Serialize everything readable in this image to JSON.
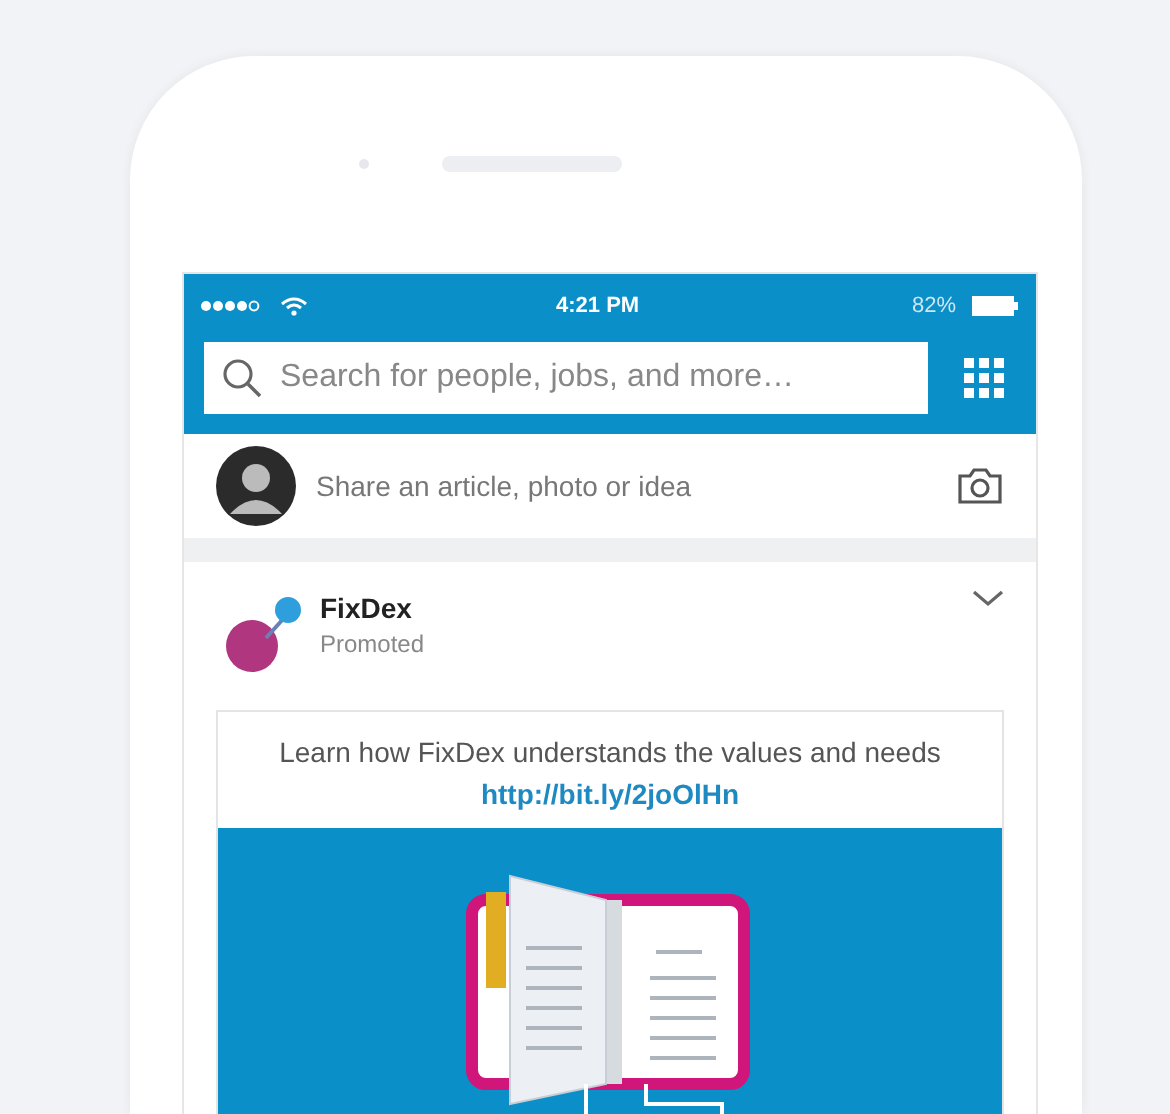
{
  "status_bar": {
    "time": "4:21 PM",
    "battery_text": "82%"
  },
  "search": {
    "placeholder": "Search for people, jobs, and more…"
  },
  "share_box": {
    "placeholder": "Share an article, photo or idea"
  },
  "post": {
    "author": "FixDex",
    "subtitle": "Promoted",
    "text": "Learn how FixDex understands the values and needs",
    "link": "http://bit.ly/2joOlHn"
  }
}
